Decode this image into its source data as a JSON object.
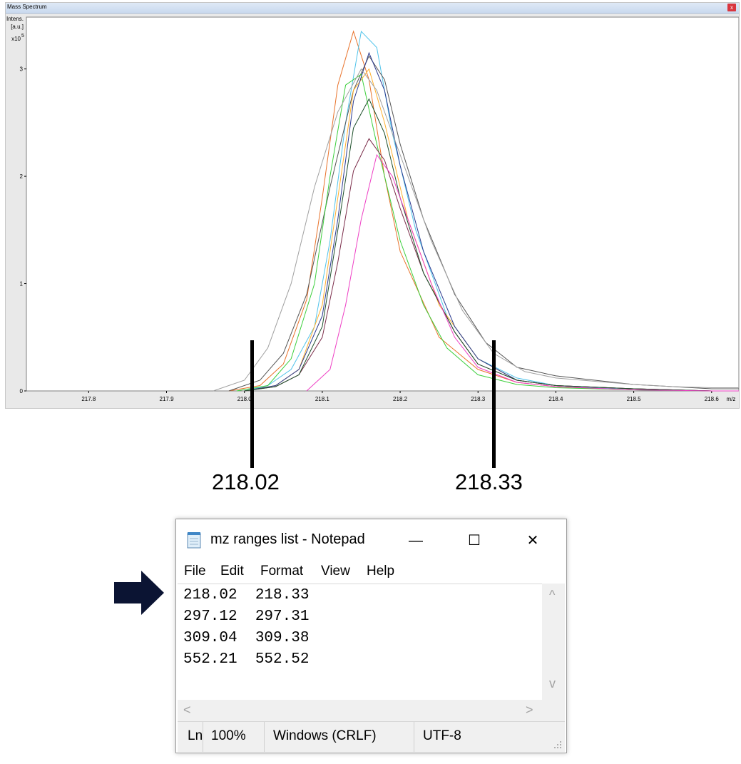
{
  "spectrum_window": {
    "title": "Mass Spectrum",
    "close_label": "x"
  },
  "chart_data": {
    "type": "line",
    "title": "",
    "ylabel_lines": [
      "Intens.",
      "[a.u.]"
    ],
    "y_scale_label": "x10",
    "y_scale_exp": "5",
    "xlabel": "m/z",
    "xlim": [
      217.72,
      218.635
    ],
    "ylim": [
      0,
      3.35
    ],
    "xticks": [
      "217.8",
      "217.9",
      "218.0",
      "218.1",
      "218.2",
      "218.3",
      "218.4",
      "218.5",
      "218.6"
    ],
    "yticks": [
      "0",
      "1",
      "2",
      "3"
    ],
    "grid": false,
    "series": [
      {
        "color": "#e8722a",
        "x": [
          217.98,
          218.02,
          218.05,
          218.08,
          218.1,
          218.12,
          218.14,
          218.16,
          218.18,
          218.2,
          218.25,
          218.3,
          218.35,
          218.4,
          218.45,
          218.5,
          218.6,
          218.635
        ],
        "values": [
          0,
          0.05,
          0.25,
          0.85,
          1.8,
          2.85,
          3.35,
          2.9,
          2.0,
          1.3,
          0.5,
          0.2,
          0.08,
          0.04,
          0.02,
          0.01,
          0,
          0
        ]
      },
      {
        "color": "#4fc3ea",
        "x": [
          218.0,
          218.03,
          218.06,
          218.09,
          218.11,
          218.13,
          218.15,
          218.17,
          218.19,
          218.22,
          218.26,
          218.3,
          218.35,
          218.4,
          218.45,
          218.5,
          218.6,
          218.635
        ],
        "values": [
          0,
          0.05,
          0.2,
          0.6,
          1.4,
          2.5,
          3.35,
          3.2,
          2.4,
          1.5,
          0.7,
          0.3,
          0.12,
          0.05,
          0.03,
          0.01,
          0,
          0
        ]
      },
      {
        "color": "#555555",
        "x": [
          217.98,
          218.02,
          218.05,
          218.08,
          218.11,
          218.14,
          218.16,
          218.18,
          218.2,
          218.23,
          218.27,
          218.31,
          218.35,
          218.4,
          218.45,
          218.5,
          218.6,
          218.635
        ],
        "values": [
          0,
          0.1,
          0.35,
          0.9,
          1.9,
          2.8,
          3.12,
          2.9,
          2.3,
          1.6,
          0.9,
          0.45,
          0.22,
          0.14,
          0.1,
          0.06,
          0.02,
          0.02
        ]
      },
      {
        "color": "#3ccf3c",
        "x": [
          217.99,
          218.03,
          218.06,
          218.09,
          218.11,
          218.13,
          218.15,
          218.17,
          218.2,
          218.23,
          218.26,
          218.3,
          218.35,
          218.4,
          218.5,
          218.6,
          218.635
        ],
        "values": [
          0,
          0.05,
          0.3,
          1.0,
          2.0,
          2.85,
          2.95,
          2.3,
          1.4,
          0.8,
          0.4,
          0.15,
          0.06,
          0.03,
          0.01,
          0,
          0
        ]
      },
      {
        "color": "#ffb02e",
        "x": [
          218.0,
          218.04,
          218.07,
          218.1,
          218.12,
          218.14,
          218.16,
          218.18,
          218.21,
          218.25,
          218.3,
          218.35,
          218.4,
          218.5,
          218.6,
          218.635
        ],
        "values": [
          0,
          0.05,
          0.2,
          0.8,
          1.8,
          2.8,
          3.0,
          2.5,
          1.6,
          0.8,
          0.3,
          0.1,
          0.05,
          0.02,
          0,
          0
        ]
      },
      {
        "color": "#2a3a8f",
        "x": [
          218.0,
          218.04,
          218.07,
          218.1,
          218.12,
          218.14,
          218.16,
          218.18,
          218.2,
          218.23,
          218.27,
          218.3,
          218.35,
          218.4,
          218.5,
          218.6,
          218.635
        ],
        "values": [
          0,
          0.05,
          0.2,
          0.7,
          1.6,
          2.7,
          3.15,
          2.8,
          2.1,
          1.3,
          0.6,
          0.3,
          0.1,
          0.05,
          0.02,
          0,
          0
        ]
      },
      {
        "color": "#7b2d4a",
        "x": [
          218.0,
          218.04,
          218.07,
          218.1,
          218.12,
          218.14,
          218.16,
          218.18,
          218.2,
          218.23,
          218.27,
          218.3,
          218.35,
          218.4,
          218.5,
          218.6,
          218.635
        ],
        "values": [
          0,
          0.04,
          0.15,
          0.5,
          1.2,
          2.05,
          2.35,
          2.15,
          1.7,
          1.1,
          0.55,
          0.25,
          0.1,
          0.05,
          0.02,
          0,
          0
        ]
      },
      {
        "color": "#1d4f2a",
        "x": [
          218.0,
          218.04,
          218.07,
          218.1,
          218.12,
          218.14,
          218.16,
          218.18,
          218.2,
          218.23,
          218.27,
          218.3,
          218.35,
          218.4,
          218.5,
          218.6,
          218.635
        ],
        "values": [
          0,
          0.04,
          0.15,
          0.6,
          1.5,
          2.45,
          2.72,
          2.4,
          1.8,
          1.1,
          0.55,
          0.25,
          0.1,
          0.05,
          0.02,
          0,
          0
        ]
      },
      {
        "color": "#ee3ec4",
        "x": [
          218.08,
          218.11,
          218.13,
          218.15,
          218.17,
          218.19,
          218.21,
          218.24,
          218.27,
          218.3,
          218.35,
          218.4,
          218.5,
          218.6,
          218.635
        ],
        "values": [
          0,
          0.2,
          0.8,
          1.6,
          2.2,
          2.0,
          1.6,
          1.0,
          0.5,
          0.22,
          0.08,
          0.04,
          0.01,
          0,
          0
        ]
      },
      {
        "color": "#a0a0a0",
        "x": [
          217.96,
          218.0,
          218.03,
          218.06,
          218.09,
          218.12,
          218.15,
          218.17,
          218.2,
          218.24,
          218.28,
          218.32,
          218.36,
          218.4,
          218.45,
          218.5,
          218.55,
          218.6,
          218.635
        ],
        "values": [
          0,
          0.1,
          0.4,
          1.0,
          1.9,
          2.6,
          3.0,
          2.8,
          2.2,
          1.4,
          0.75,
          0.35,
          0.18,
          0.12,
          0.09,
          0.06,
          0.04,
          0.03,
          0.03
        ]
      }
    ]
  },
  "annotations": {
    "left_label": "218.02",
    "right_label": "218.33"
  },
  "notepad": {
    "title": "mz ranges list - Notepad",
    "minimize_label": "—",
    "maximize_label": "☐",
    "close_label": "✕",
    "menu": [
      "File",
      "Edit",
      "Format",
      "View",
      "Help"
    ],
    "lines": [
      "218.02  218.33",
      "297.12  297.31",
      "309.04  309.38",
      "552.21  552.52"
    ],
    "status": {
      "line_col": "Ln",
      "zoom": "100%",
      "line_ending": "Windows (CRLF)",
      "encoding": "UTF-8"
    },
    "scroll_up": "^",
    "scroll_down": "v",
    "scroll_left": "<",
    "scroll_right": ">"
  }
}
